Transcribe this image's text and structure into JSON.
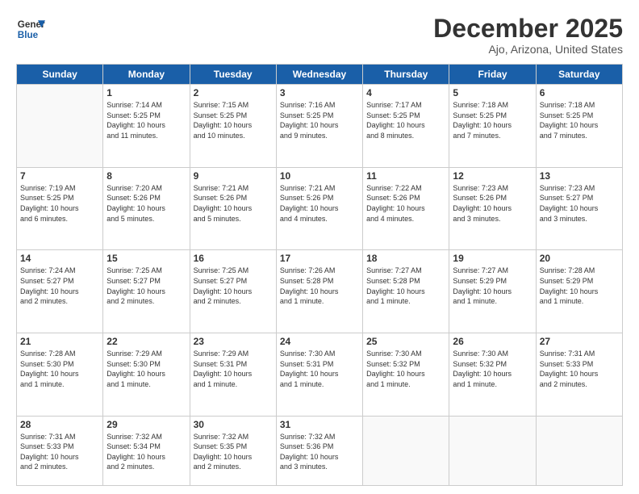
{
  "header": {
    "logo_text_line1": "General",
    "logo_text_line2": "Blue",
    "title": "December 2025",
    "subtitle": "Ajo, Arizona, United States"
  },
  "days_of_week": [
    "Sunday",
    "Monday",
    "Tuesday",
    "Wednesday",
    "Thursday",
    "Friday",
    "Saturday"
  ],
  "weeks": [
    [
      {
        "day": "",
        "info": ""
      },
      {
        "day": "1",
        "info": "Sunrise: 7:14 AM\nSunset: 5:25 PM\nDaylight: 10 hours\nand 11 minutes."
      },
      {
        "day": "2",
        "info": "Sunrise: 7:15 AM\nSunset: 5:25 PM\nDaylight: 10 hours\nand 10 minutes."
      },
      {
        "day": "3",
        "info": "Sunrise: 7:16 AM\nSunset: 5:25 PM\nDaylight: 10 hours\nand 9 minutes."
      },
      {
        "day": "4",
        "info": "Sunrise: 7:17 AM\nSunset: 5:25 PM\nDaylight: 10 hours\nand 8 minutes."
      },
      {
        "day": "5",
        "info": "Sunrise: 7:18 AM\nSunset: 5:25 PM\nDaylight: 10 hours\nand 7 minutes."
      },
      {
        "day": "6",
        "info": "Sunrise: 7:18 AM\nSunset: 5:25 PM\nDaylight: 10 hours\nand 7 minutes."
      }
    ],
    [
      {
        "day": "7",
        "info": "Sunrise: 7:19 AM\nSunset: 5:25 PM\nDaylight: 10 hours\nand 6 minutes."
      },
      {
        "day": "8",
        "info": "Sunrise: 7:20 AM\nSunset: 5:26 PM\nDaylight: 10 hours\nand 5 minutes."
      },
      {
        "day": "9",
        "info": "Sunrise: 7:21 AM\nSunset: 5:26 PM\nDaylight: 10 hours\nand 5 minutes."
      },
      {
        "day": "10",
        "info": "Sunrise: 7:21 AM\nSunset: 5:26 PM\nDaylight: 10 hours\nand 4 minutes."
      },
      {
        "day": "11",
        "info": "Sunrise: 7:22 AM\nSunset: 5:26 PM\nDaylight: 10 hours\nand 4 minutes."
      },
      {
        "day": "12",
        "info": "Sunrise: 7:23 AM\nSunset: 5:26 PM\nDaylight: 10 hours\nand 3 minutes."
      },
      {
        "day": "13",
        "info": "Sunrise: 7:23 AM\nSunset: 5:27 PM\nDaylight: 10 hours\nand 3 minutes."
      }
    ],
    [
      {
        "day": "14",
        "info": "Sunrise: 7:24 AM\nSunset: 5:27 PM\nDaylight: 10 hours\nand 2 minutes."
      },
      {
        "day": "15",
        "info": "Sunrise: 7:25 AM\nSunset: 5:27 PM\nDaylight: 10 hours\nand 2 minutes."
      },
      {
        "day": "16",
        "info": "Sunrise: 7:25 AM\nSunset: 5:27 PM\nDaylight: 10 hours\nand 2 minutes."
      },
      {
        "day": "17",
        "info": "Sunrise: 7:26 AM\nSunset: 5:28 PM\nDaylight: 10 hours\nand 1 minute."
      },
      {
        "day": "18",
        "info": "Sunrise: 7:27 AM\nSunset: 5:28 PM\nDaylight: 10 hours\nand 1 minute."
      },
      {
        "day": "19",
        "info": "Sunrise: 7:27 AM\nSunset: 5:29 PM\nDaylight: 10 hours\nand 1 minute."
      },
      {
        "day": "20",
        "info": "Sunrise: 7:28 AM\nSunset: 5:29 PM\nDaylight: 10 hours\nand 1 minute."
      }
    ],
    [
      {
        "day": "21",
        "info": "Sunrise: 7:28 AM\nSunset: 5:30 PM\nDaylight: 10 hours\nand 1 minute."
      },
      {
        "day": "22",
        "info": "Sunrise: 7:29 AM\nSunset: 5:30 PM\nDaylight: 10 hours\nand 1 minute."
      },
      {
        "day": "23",
        "info": "Sunrise: 7:29 AM\nSunset: 5:31 PM\nDaylight: 10 hours\nand 1 minute."
      },
      {
        "day": "24",
        "info": "Sunrise: 7:30 AM\nSunset: 5:31 PM\nDaylight: 10 hours\nand 1 minute."
      },
      {
        "day": "25",
        "info": "Sunrise: 7:30 AM\nSunset: 5:32 PM\nDaylight: 10 hours\nand 1 minute."
      },
      {
        "day": "26",
        "info": "Sunrise: 7:30 AM\nSunset: 5:32 PM\nDaylight: 10 hours\nand 1 minute."
      },
      {
        "day": "27",
        "info": "Sunrise: 7:31 AM\nSunset: 5:33 PM\nDaylight: 10 hours\nand 2 minutes."
      }
    ],
    [
      {
        "day": "28",
        "info": "Sunrise: 7:31 AM\nSunset: 5:33 PM\nDaylight: 10 hours\nand 2 minutes."
      },
      {
        "day": "29",
        "info": "Sunrise: 7:32 AM\nSunset: 5:34 PM\nDaylight: 10 hours\nand 2 minutes."
      },
      {
        "day": "30",
        "info": "Sunrise: 7:32 AM\nSunset: 5:35 PM\nDaylight: 10 hours\nand 2 minutes."
      },
      {
        "day": "31",
        "info": "Sunrise: 7:32 AM\nSunset: 5:36 PM\nDaylight: 10 hours\nand 3 minutes."
      },
      {
        "day": "",
        "info": ""
      },
      {
        "day": "",
        "info": ""
      },
      {
        "day": "",
        "info": ""
      }
    ]
  ]
}
